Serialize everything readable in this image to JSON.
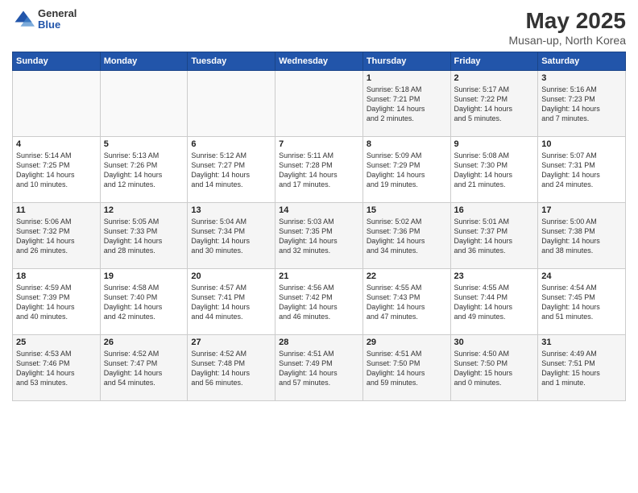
{
  "header": {
    "logo_general": "General",
    "logo_blue": "Blue",
    "title": "May 2025",
    "location": "Musan-up, North Korea"
  },
  "weekdays": [
    "Sunday",
    "Monday",
    "Tuesday",
    "Wednesday",
    "Thursday",
    "Friday",
    "Saturday"
  ],
  "weeks": [
    [
      {
        "day": "",
        "content": ""
      },
      {
        "day": "",
        "content": ""
      },
      {
        "day": "",
        "content": ""
      },
      {
        "day": "",
        "content": ""
      },
      {
        "day": "1",
        "content": "Sunrise: 5:18 AM\nSunset: 7:21 PM\nDaylight: 14 hours\nand 2 minutes."
      },
      {
        "day": "2",
        "content": "Sunrise: 5:17 AM\nSunset: 7:22 PM\nDaylight: 14 hours\nand 5 minutes."
      },
      {
        "day": "3",
        "content": "Sunrise: 5:16 AM\nSunset: 7:23 PM\nDaylight: 14 hours\nand 7 minutes."
      }
    ],
    [
      {
        "day": "4",
        "content": "Sunrise: 5:14 AM\nSunset: 7:25 PM\nDaylight: 14 hours\nand 10 minutes."
      },
      {
        "day": "5",
        "content": "Sunrise: 5:13 AM\nSunset: 7:26 PM\nDaylight: 14 hours\nand 12 minutes."
      },
      {
        "day": "6",
        "content": "Sunrise: 5:12 AM\nSunset: 7:27 PM\nDaylight: 14 hours\nand 14 minutes."
      },
      {
        "day": "7",
        "content": "Sunrise: 5:11 AM\nSunset: 7:28 PM\nDaylight: 14 hours\nand 17 minutes."
      },
      {
        "day": "8",
        "content": "Sunrise: 5:09 AM\nSunset: 7:29 PM\nDaylight: 14 hours\nand 19 minutes."
      },
      {
        "day": "9",
        "content": "Sunrise: 5:08 AM\nSunset: 7:30 PM\nDaylight: 14 hours\nand 21 minutes."
      },
      {
        "day": "10",
        "content": "Sunrise: 5:07 AM\nSunset: 7:31 PM\nDaylight: 14 hours\nand 24 minutes."
      }
    ],
    [
      {
        "day": "11",
        "content": "Sunrise: 5:06 AM\nSunset: 7:32 PM\nDaylight: 14 hours\nand 26 minutes."
      },
      {
        "day": "12",
        "content": "Sunrise: 5:05 AM\nSunset: 7:33 PM\nDaylight: 14 hours\nand 28 minutes."
      },
      {
        "day": "13",
        "content": "Sunrise: 5:04 AM\nSunset: 7:34 PM\nDaylight: 14 hours\nand 30 minutes."
      },
      {
        "day": "14",
        "content": "Sunrise: 5:03 AM\nSunset: 7:35 PM\nDaylight: 14 hours\nand 32 minutes."
      },
      {
        "day": "15",
        "content": "Sunrise: 5:02 AM\nSunset: 7:36 PM\nDaylight: 14 hours\nand 34 minutes."
      },
      {
        "day": "16",
        "content": "Sunrise: 5:01 AM\nSunset: 7:37 PM\nDaylight: 14 hours\nand 36 minutes."
      },
      {
        "day": "17",
        "content": "Sunrise: 5:00 AM\nSunset: 7:38 PM\nDaylight: 14 hours\nand 38 minutes."
      }
    ],
    [
      {
        "day": "18",
        "content": "Sunrise: 4:59 AM\nSunset: 7:39 PM\nDaylight: 14 hours\nand 40 minutes."
      },
      {
        "day": "19",
        "content": "Sunrise: 4:58 AM\nSunset: 7:40 PM\nDaylight: 14 hours\nand 42 minutes."
      },
      {
        "day": "20",
        "content": "Sunrise: 4:57 AM\nSunset: 7:41 PM\nDaylight: 14 hours\nand 44 minutes."
      },
      {
        "day": "21",
        "content": "Sunrise: 4:56 AM\nSunset: 7:42 PM\nDaylight: 14 hours\nand 46 minutes."
      },
      {
        "day": "22",
        "content": "Sunrise: 4:55 AM\nSunset: 7:43 PM\nDaylight: 14 hours\nand 47 minutes."
      },
      {
        "day": "23",
        "content": "Sunrise: 4:55 AM\nSunset: 7:44 PM\nDaylight: 14 hours\nand 49 minutes."
      },
      {
        "day": "24",
        "content": "Sunrise: 4:54 AM\nSunset: 7:45 PM\nDaylight: 14 hours\nand 51 minutes."
      }
    ],
    [
      {
        "day": "25",
        "content": "Sunrise: 4:53 AM\nSunset: 7:46 PM\nDaylight: 14 hours\nand 53 minutes."
      },
      {
        "day": "26",
        "content": "Sunrise: 4:52 AM\nSunset: 7:47 PM\nDaylight: 14 hours\nand 54 minutes."
      },
      {
        "day": "27",
        "content": "Sunrise: 4:52 AM\nSunset: 7:48 PM\nDaylight: 14 hours\nand 56 minutes."
      },
      {
        "day": "28",
        "content": "Sunrise: 4:51 AM\nSunset: 7:49 PM\nDaylight: 14 hours\nand 57 minutes."
      },
      {
        "day": "29",
        "content": "Sunrise: 4:51 AM\nSunset: 7:50 PM\nDaylight: 14 hours\nand 59 minutes."
      },
      {
        "day": "30",
        "content": "Sunrise: 4:50 AM\nSunset: 7:50 PM\nDaylight: 15 hours\nand 0 minutes."
      },
      {
        "day": "31",
        "content": "Sunrise: 4:49 AM\nSunset: 7:51 PM\nDaylight: 15 hours\nand 1 minute."
      }
    ]
  ]
}
